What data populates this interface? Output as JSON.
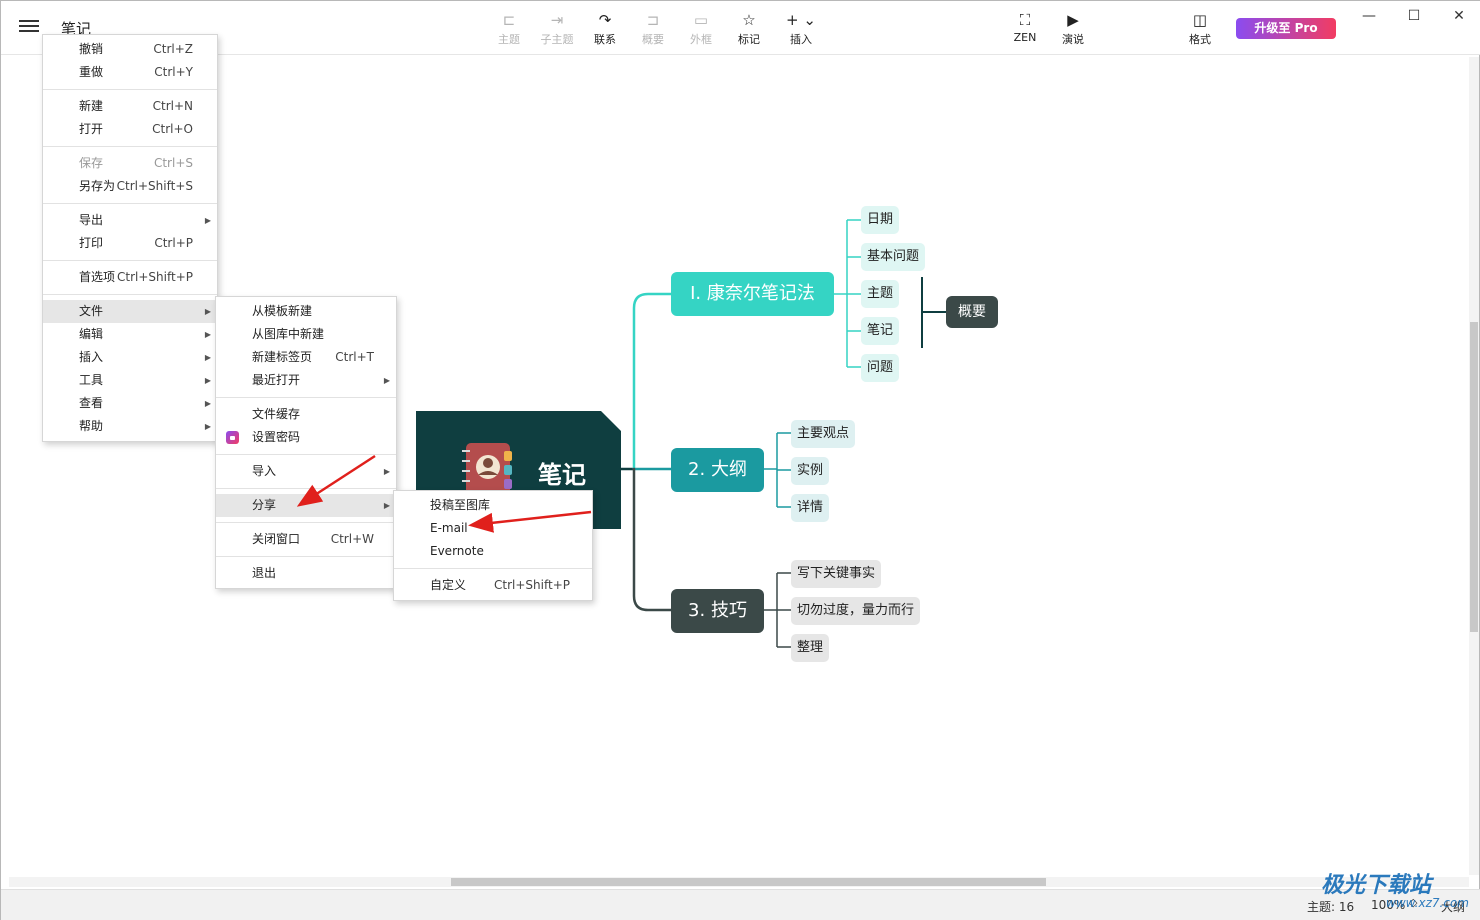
{
  "app": {
    "title": "笔记"
  },
  "toolbar": [
    {
      "label": "主题",
      "icon": "topic-icon",
      "enabled": false
    },
    {
      "label": "子主题",
      "icon": "subtopic-icon",
      "enabled": false
    },
    {
      "label": "联系",
      "icon": "relationship-icon",
      "enabled": true
    },
    {
      "label": "概要",
      "icon": "summary-icon",
      "enabled": false
    },
    {
      "label": "外框",
      "icon": "boundary-icon",
      "enabled": false
    },
    {
      "label": "标记",
      "icon": "star-icon",
      "enabled": true
    },
    {
      "label": "插入",
      "icon": "plus-icon",
      "enabled": true
    }
  ],
  "toolbar_right": {
    "zen": "ZEN",
    "present": "演说",
    "format": "格式",
    "pro": "升级至 Pro"
  },
  "main_menu": {
    "undo": {
      "label": "撤销",
      "shortcut": "Ctrl+Z"
    },
    "redo": {
      "label": "重做",
      "shortcut": "Ctrl+Y"
    },
    "new": {
      "label": "新建",
      "shortcut": "Ctrl+N"
    },
    "open": {
      "label": "打开",
      "shortcut": "Ctrl+O"
    },
    "save": {
      "label": "保存",
      "shortcut": "Ctrl+S"
    },
    "save_as": {
      "label": "另存为",
      "shortcut": "Ctrl+Shift+S"
    },
    "export": {
      "label": "导出"
    },
    "print": {
      "label": "打印",
      "shortcut": "Ctrl+P"
    },
    "prefs": {
      "label": "首选项",
      "shortcut": "Ctrl+Shift+P"
    },
    "file": {
      "label": "文件"
    },
    "edit": {
      "label": "编辑"
    },
    "insert": {
      "label": "插入"
    },
    "tools": {
      "label": "工具"
    },
    "view": {
      "label": "查看"
    },
    "help": {
      "label": "帮助"
    }
  },
  "file_menu": {
    "from_template": {
      "label": "从模板新建"
    },
    "from_gallery": {
      "label": "从图库中新建"
    },
    "new_tab": {
      "label": "新建标签页",
      "shortcut": "Ctrl+T"
    },
    "recent": {
      "label": "最近打开"
    },
    "cache": {
      "label": "文件缓存"
    },
    "password": {
      "label": "设置密码"
    },
    "import": {
      "label": "导入"
    },
    "share": {
      "label": "分享"
    },
    "close": {
      "label": "关闭窗口",
      "shortcut": "Ctrl+W"
    },
    "quit": {
      "label": "退出"
    }
  },
  "share_menu": {
    "gallery": {
      "label": "投稿至图库"
    },
    "email": {
      "label": "E-mail"
    },
    "evernote": {
      "label": "Evernote"
    },
    "custom": {
      "label": "自定义",
      "shortcut": "Ctrl+Shift+P"
    }
  },
  "mindmap": {
    "central": "笔记",
    "branches": [
      {
        "title": "I. 康奈尔笔记法",
        "color": "#35d4c4",
        "children": [
          "日期",
          "基本问题",
          "主题",
          "笔记",
          "问题"
        ],
        "summary": "概要"
      },
      {
        "title": "2. 大纲",
        "color": "#1b9aa0",
        "children": [
          "主要观点",
          "实例",
          "详情"
        ]
      },
      {
        "title": "3. 技巧",
        "color": "#3b4948",
        "children": [
          "写下关键事实",
          "切勿过度，量力而行",
          "整理"
        ]
      }
    ]
  },
  "status": {
    "topics": "主题: 16",
    "zoom": "100%",
    "view": "大纲"
  },
  "watermark": {
    "text": "极光下载站",
    "url": "www.xz7.com"
  }
}
